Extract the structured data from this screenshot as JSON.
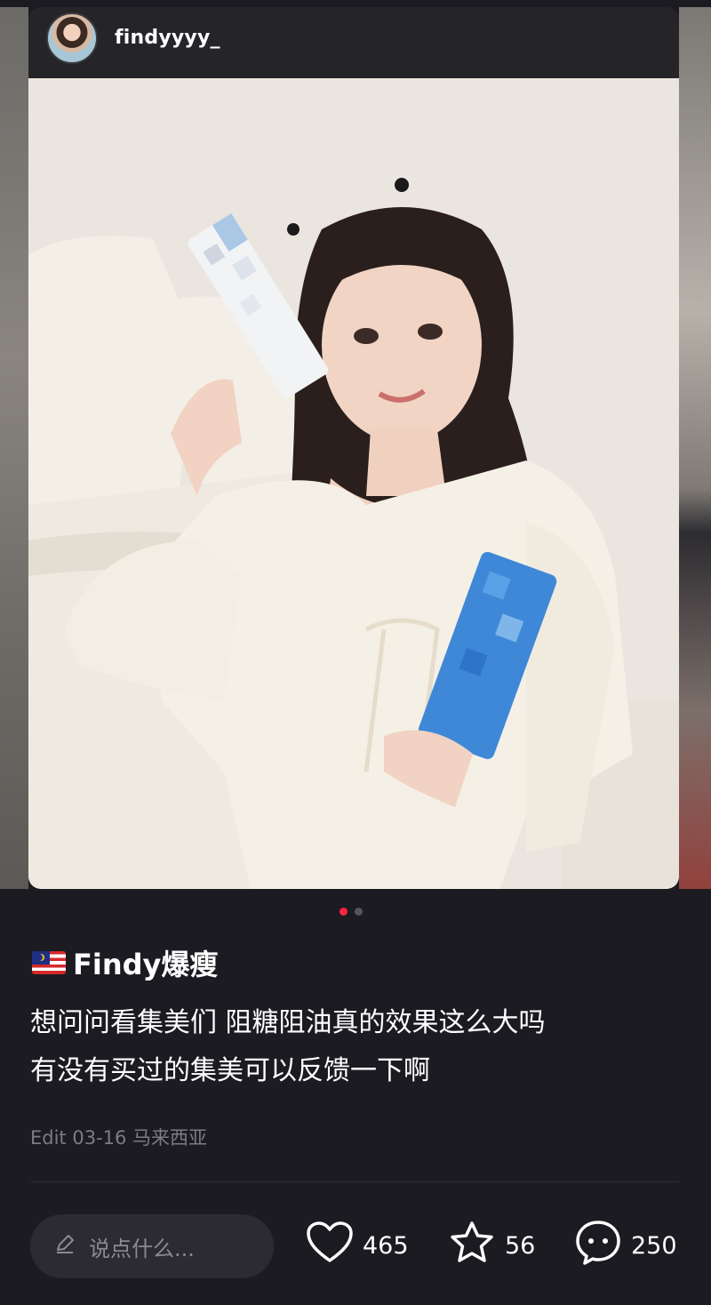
{
  "header": {
    "username": "findyyyy_"
  },
  "carousel": {
    "total": 2,
    "active_index": 0,
    "active_color": "#ff2442"
  },
  "post": {
    "flag": "malaysia-flag-icon",
    "title": "Findy爆瘦",
    "body_lines": [
      "想问问看集美们 阻糖阻油真的效果这么大吗",
      "有没有买过的集美可以反馈一下啊"
    ],
    "meta": "Edit 03-16 马来西亚"
  },
  "actions": {
    "comment_placeholder": "说点什么...",
    "likes": "465",
    "favorites": "56",
    "comments": "250"
  },
  "colors": {
    "background": "#1c1b21",
    "input_bg": "#2c2b31",
    "muted_text": "#7c7b82"
  }
}
